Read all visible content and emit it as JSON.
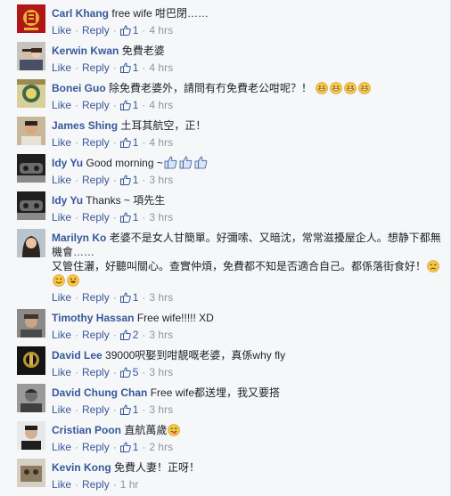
{
  "labels": {
    "like": "Like",
    "reply": "Reply",
    "separator": "·"
  },
  "comments": [
    {
      "author": "Carl Khang",
      "text": "free wife 咁巴閉……",
      "likes": "1",
      "time": "4 hrs"
    },
    {
      "author": "Kerwin Kwan",
      "text": "免費老婆",
      "likes": "1",
      "time": "4 hrs"
    },
    {
      "author": "Bonei Guo",
      "text": "除免費老婆外，請問有冇免費老公咁呢？！",
      "likes": "1",
      "time": "4 hrs",
      "emojis": [
        "grin-emoji",
        "grin-emoji",
        "grin-emoji",
        "grin-emoji"
      ]
    },
    {
      "author": "James Shing",
      "text": "土耳其航空，正！",
      "likes": "1",
      "time": "4 hrs"
    },
    {
      "author": "Idy Yu",
      "text": "Good morning ~",
      "likes": "1",
      "time": "3 hrs",
      "thumbs": 3
    },
    {
      "author": "Idy Yu",
      "text": "Thanks ~ 項先生",
      "likes": "1",
      "time": "3 hrs"
    },
    {
      "author": "Marilyn Ko",
      "text_line1": "老婆不是女人甘簡單。好彌嗦、又暗沈，常常滋擾屋企人。想静下都無機會……",
      "text_line2": "又管住灑，好聽叫關心。查實仲煩，免費都不知是否適合自己。都係落街食好！",
      "likes": "1",
      "time": "3 hrs",
      "emojis": [
        "sad-emoji",
        "smile-emoji",
        "laugh-emoji"
      ]
    },
    {
      "author": "Timothy Hassan",
      "text": "Free wife!!!!! XD",
      "likes": "2",
      "time": "3 hrs"
    },
    {
      "author": "David Lee",
      "text": "39000呎娶到咁靚嘅老婆，真係why fly",
      "likes": "5",
      "time": "3 hrs"
    },
    {
      "author": "David Chung Chan",
      "text": "Free wife都送埋，我又要搭",
      "likes": "1",
      "time": "3 hrs"
    },
    {
      "author": "Cristian Poon",
      "text": "直航萬歲",
      "likes": "1",
      "time": "2 hrs",
      "emojis": [
        "tongue-emoji"
      ]
    },
    {
      "author": "Kevin Kong",
      "text": "免費人妻！正呀！",
      "likes": "",
      "time": "1 hr"
    }
  ]
}
